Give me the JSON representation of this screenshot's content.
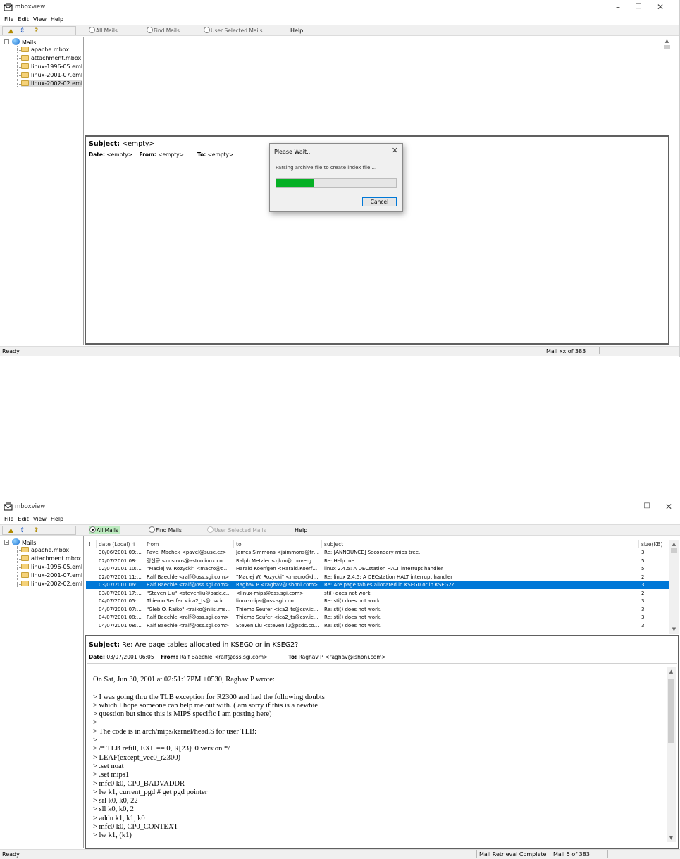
{
  "app": {
    "title": "mboxview",
    "menu": [
      "File",
      "Edit",
      "View",
      "Help"
    ]
  },
  "toolbar": {
    "radio_all": "All Mails",
    "radio_find": "Find Mails",
    "radio_user": "User Selected Mails",
    "help": "Help"
  },
  "tree": {
    "root": "Mails",
    "items": [
      "apache.mbox",
      "attachment.mbox",
      "linux-1996-05.eml",
      "linux-2001-07.eml",
      "linux-2002-02.eml"
    ]
  },
  "screen1": {
    "subject_label": "Subject:",
    "subject_value": "<empty>",
    "date_label": "Date:",
    "date_value": "<empty>",
    "from_label": "From:",
    "from_value": "<empty>",
    "to_label": "To:",
    "to_value": "<empty>",
    "status_left": "Ready",
    "status_right": "Mail xx of 383",
    "dialog": {
      "title": "Please Wait..",
      "message": "Parsing archive file to create index file ...",
      "progress": 0.32,
      "cancel": "Cancel"
    }
  },
  "screen2": {
    "columns": {
      "flag": "!",
      "date": "date (Local) ↑",
      "from": "from",
      "to": "to",
      "subject": "subject",
      "size": "size(KB)"
    },
    "rows": [
      {
        "date": "30/06/2001 09:57",
        "from": "Pavel Machek <pavel@suse.cz>",
        "to": "James Simmons <jsimmons@transv...",
        "subject": "Re: [ANNOUNCE] Secondary mips tree.",
        "size": "3"
      },
      {
        "date": "02/07/2001 08:47",
        "from": "강산규 <cosmos@astonlinux.com>",
        "to": "Ralph Metzler <rjkm@convergenc...",
        "subject": "Re: Help me.",
        "size": "5"
      },
      {
        "date": "02/07/2001 10:06",
        "from": "\"Maciej W. Rozycki\" <macro@ds2...",
        "to": "Harald Koerfgen <Harald.Koerfge...",
        "subject": "linux 2.4.5: A DECstation HALT interrupt handler",
        "size": "5"
      },
      {
        "date": "02/07/2001 11:05",
        "from": "Ralf Baechle <ralf@oss.sgi.com>",
        "to": "\"Maciej W. Rozycki\" <macro@ds2...",
        "subject": "Re: linux 2.4.5: A DECstation HALT interrupt handler",
        "size": "2"
      },
      {
        "date": "03/07/2001 06:05",
        "from": "Ralf Baechle <ralf@oss.sgi.com>",
        "to": "Raghav P <raghav@ishoni.com>",
        "subject": "Re: Are page tables allocated in KSEG0 or in KSEG2?",
        "size": "3"
      },
      {
        "date": "03/07/2001 17:48",
        "from": "\"Steven Liu\" <stevenliu@psdc.com>",
        "to": "<linux-mips@oss.sgi.com>",
        "subject": "sti() does not work.",
        "size": "2"
      },
      {
        "date": "04/07/2001 05:23",
        "from": "Thiemo Seufer <ica2_ts@csv.ica.u...",
        "to": "linux-mips@oss.sgi.com",
        "subject": "Re: sti() does not work.",
        "size": "3"
      },
      {
        "date": "04/07/2001 07:23",
        "from": "\"Gleb O. Raiko\" <raiko@niisi.msk.ru>",
        "to": "Thiemo Seufer <ica2_ts@csv.ica.u...",
        "subject": "Re: sti() does not work.",
        "size": "3"
      },
      {
        "date": "04/07/2001 08:26",
        "from": "Ralf Baechle <ralf@oss.sgi.com>",
        "to": "Thiemo Seufer <ica2_ts@csv.ica.u...",
        "subject": "Re: sti() does not work.",
        "size": "3"
      },
      {
        "date": "04/07/2001 08:29",
        "from": "Ralf Baechle <ralf@oss.sgi.com>",
        "to": "Steven Liu <stevenliu@psdc.com>",
        "subject": "Re: sti() does not work.",
        "size": "3"
      }
    ],
    "subject_label": "Subject:",
    "subject_value": "Re: Are page tables allocated in KSEG0 or in KSEG2?",
    "date_label": "Date:",
    "date_value": "03/07/2001 06:05",
    "from_label": "From:",
    "from_value": "Ralf Baechle <ralf@oss.sgi.com>",
    "to_label": "To:",
    "to_value": "Raghav P <raghav@ishoni.com>",
    "body": "On Sat, Jun 30, 2001 at 02:51:17PM +0530, Raghav P wrote:\n\n> I was going thru the TLB exception for R2300 and had the following doubts\n> which I hope someone can help me out with. ( am sorry if this is a newbie\n> question but since this is MIPS specific I am posting here)\n>\n> The code is in arch/mips/kernel/head.S for user TLB:\n>\n> /* TLB refill, EXL == 0, R[23]00 version */\n> LEAF(except_vec0_r2300)\n> .set noat\n> .set mips1\n> mfc0 k0, CP0_BADVADDR\n> lw k1, current_pgd # get pgd pointer\n> srl k0, k0, 22\n> sll k0, k0, 2\n> addu k1, k1, k0\n> mfc0 k0, CP0_CONTEXT\n> lw k1, (k1)",
    "status_left": "Ready",
    "status_mid": "Mail Retrieval Complete",
    "status_right": "Mail 5 of 383"
  }
}
